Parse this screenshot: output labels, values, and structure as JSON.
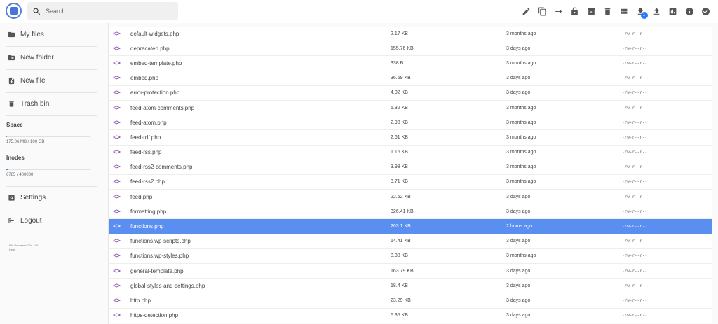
{
  "search": {
    "placeholder": "Search..."
  },
  "toolbar": {
    "actions": [
      "edit-icon",
      "copy-icon",
      "move-icon",
      "lock-icon",
      "archive-icon",
      "delete-icon",
      "grid-view-icon",
      "download-icon",
      "upload-icon",
      "info-chart-icon",
      "info-icon",
      "select-all-icon"
    ],
    "download_badge": "1"
  },
  "sidebar": {
    "items": [
      {
        "label": "My files",
        "icon": "folder-icon"
      },
      {
        "label": "New folder",
        "icon": "new-folder-icon"
      },
      {
        "label": "New file",
        "icon": "new-file-icon"
      },
      {
        "label": "Trash bin",
        "icon": "trash-icon"
      }
    ],
    "space_title": "Space",
    "space_value": "175.06 MB / 100 GB",
    "space_fraction": 0.0017,
    "inodes_title": "Inodes",
    "inodes_value": "6785 / 400000",
    "inodes_fraction": 0.017,
    "settings_label": "Settings",
    "logout_label": "Logout",
    "credits_line1": "File Browser v2.24.1/61",
    "credits_line2": "Help"
  },
  "files": [
    {
      "name": "default-widgets.php",
      "size": "2.17 KB",
      "modified": "3 months ago",
      "perm": "-rw-r--r--"
    },
    {
      "name": "deprecated.php",
      "size": "155.76 KB",
      "modified": "3 days ago",
      "perm": "-rw-r--r--"
    },
    {
      "name": "embed-template.php",
      "size": "338 B",
      "modified": "3 months ago",
      "perm": "-rw-r--r--"
    },
    {
      "name": "embed.php",
      "size": "36.59 KB",
      "modified": "3 days ago",
      "perm": "-rw-r--r--"
    },
    {
      "name": "error-protection.php",
      "size": "4.02 KB",
      "modified": "3 days ago",
      "perm": "-rw-r--r--"
    },
    {
      "name": "feed-atom-comments.php",
      "size": "5.32 KB",
      "modified": "3 months ago",
      "perm": "-rw-r--r--"
    },
    {
      "name": "feed-atom.php",
      "size": "2.98 KB",
      "modified": "3 months ago",
      "perm": "-rw-r--r--"
    },
    {
      "name": "feed-rdf.php",
      "size": "2.61 KB",
      "modified": "3 months ago",
      "perm": "-rw-r--r--"
    },
    {
      "name": "feed-rss.php",
      "size": "1.16 KB",
      "modified": "3 months ago",
      "perm": "-rw-r--r--"
    },
    {
      "name": "feed-rss2-comments.php",
      "size": "3.98 KB",
      "modified": "3 months ago",
      "perm": "-rw-r--r--"
    },
    {
      "name": "feed-rss2.php",
      "size": "3.71 KB",
      "modified": "3 months ago",
      "perm": "-rw-r--r--"
    },
    {
      "name": "feed.php",
      "size": "22.52 KB",
      "modified": "3 days ago",
      "perm": "-rw-r--r--"
    },
    {
      "name": "formatting.php",
      "size": "326.41 KB",
      "modified": "3 days ago",
      "perm": "-rw-r--r--"
    },
    {
      "name": "functions.php",
      "size": "263.1 KB",
      "modified": "2 hours ago",
      "perm": "-rw-r--r--",
      "selected": true
    },
    {
      "name": "functions.wp-scripts.php",
      "size": "14.41 KB",
      "modified": "3 days ago",
      "perm": "-rw-r--r--"
    },
    {
      "name": "functions.wp-styles.php",
      "size": "8.38 KB",
      "modified": "3 months ago",
      "perm": "-rw-r--r--"
    },
    {
      "name": "general-template.php",
      "size": "163.79 KB",
      "modified": "3 days ago",
      "perm": "-rw-r--r--"
    },
    {
      "name": "global-styles-and-settings.php",
      "size": "18.4 KB",
      "modified": "3 days ago",
      "perm": "-rw-r--r--"
    },
    {
      "name": "http.php",
      "size": "23.29 KB",
      "modified": "3 days ago",
      "perm": "-rw-r--r--"
    },
    {
      "name": "https-detection.php",
      "size": "6.35 KB",
      "modified": "3 days ago",
      "perm": "-rw-r--r--"
    }
  ],
  "colors": {
    "accent": "#5a8ef0",
    "code_icon": "#7a3da8",
    "progress": "#2196f3"
  }
}
